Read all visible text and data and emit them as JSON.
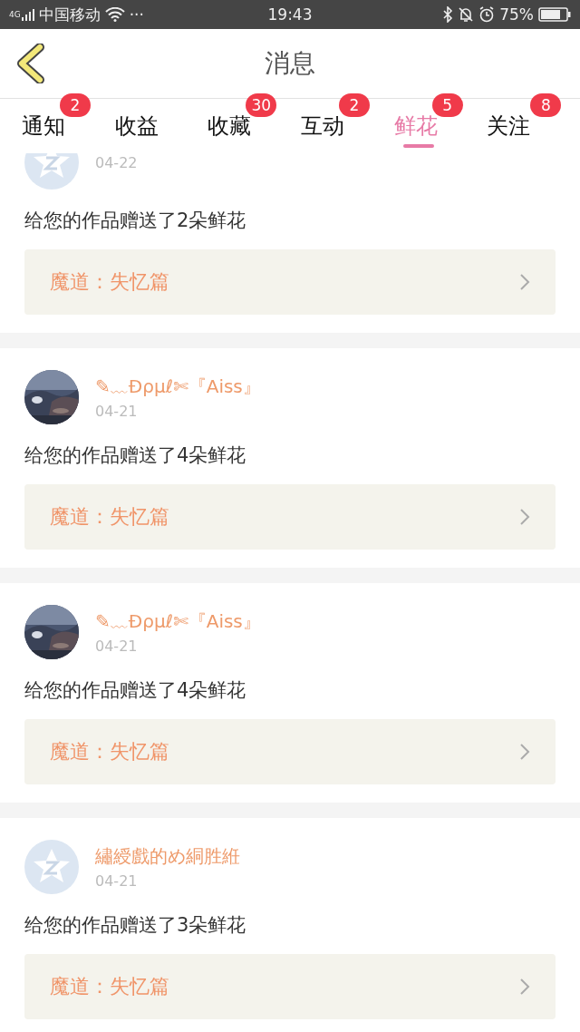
{
  "status_bar": {
    "network": "4G",
    "carrier": "中国移动",
    "more": "···",
    "time": "19:43",
    "battery": "75%"
  },
  "header": {
    "title": "消息"
  },
  "tabs": [
    {
      "label": "通知",
      "badge": "2",
      "selected": false
    },
    {
      "label": "收益",
      "selected": false
    },
    {
      "label": "收藏",
      "badge": "30",
      "selected": false
    },
    {
      "label": "互动",
      "badge": "2",
      "selected": false
    },
    {
      "label": "鲜花",
      "badge": "5",
      "selected": true
    },
    {
      "label": "关注",
      "badge": "8",
      "selected": false
    }
  ],
  "messages": [
    {
      "kind": "default",
      "date": "04-22",
      "text": "给您的作品赠送了2朵鲜花",
      "work": "魔道：失忆篇"
    },
    {
      "kind": "picture",
      "name": "✎﹏Ðρμℓ✄『Aiss』",
      "date": "04-21",
      "text": "给您的作品赠送了4朵鲜花",
      "work": "魔道：失忆篇"
    },
    {
      "kind": "picture",
      "name": "✎﹏Ðρμℓ✄『Aiss』",
      "date": "04-21",
      "text": "给您的作品赠送了4朵鲜花",
      "work": "魔道：失忆篇"
    },
    {
      "kind": "default",
      "name": "繡綬戲的め絧胜絍",
      "date": "04-21",
      "text": "给您的作品赠送了3朵鲜花",
      "work": "魔道：失忆篇"
    }
  ]
}
